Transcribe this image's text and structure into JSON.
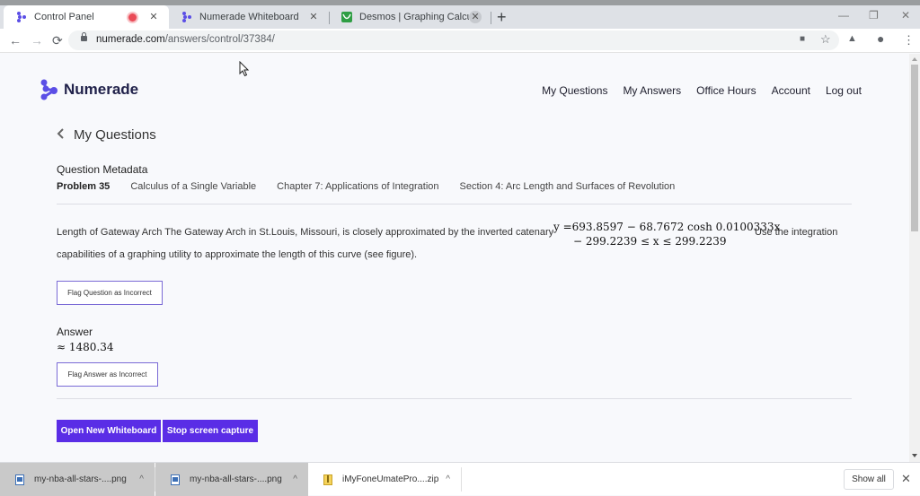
{
  "browser": {
    "tabs": [
      {
        "title": "Control Panel",
        "active": true,
        "recording": true
      },
      {
        "title": "Numerade Whiteboard",
        "active": false
      },
      {
        "title": "Desmos | Graphing Calculator",
        "active": false
      }
    ],
    "url_host": "numerade.com",
    "url_path": "/answers/control/37384/",
    "icons": {
      "back": "←",
      "forward": "→",
      "reload": "⟳",
      "close": "✕",
      "new_tab": "+",
      "minimize": "—",
      "restore": "❐",
      "window_close": "✕",
      "camera": "■",
      "star": "☆",
      "drive": "▲",
      "profile": "●",
      "menu": "⋮"
    }
  },
  "site": {
    "brand": "Numerade",
    "brand_color": "#5b4ee6",
    "nav": [
      "My Questions",
      "My Answers",
      "Office Hours",
      "Account",
      "Log out"
    ]
  },
  "page": {
    "back_label": "My Questions",
    "back_chevron": "‹",
    "metadata_title": "Question Metadata",
    "problem": "Problem 35",
    "book": "Calculus of a Single Variable",
    "chapter": "Chapter 7: Applications of Integration",
    "section": "Section 4: Arc Length and Surfaces of Revolution",
    "question_text_1": "Length of Gateway Arch The Gateway Arch in St.Louis, Missouri, is closely approximated by the inverted catenary",
    "math_line1": "y =693.8597 − 68.7672 cosh 0.0100333x",
    "math_line2": "− 299.2239 ≤ x ≤ 299.2239",
    "question_text_after": "Use the integration",
    "question_text_2": "capabilities of a graphing utility to approximate the length of this curve (see figure).",
    "flag_question_label": "Flag Question as Incorrect",
    "answer_label": "Answer",
    "answer_value": "≈ 1480.34",
    "flag_answer_label": "Flag Answer as Incorrect",
    "open_whiteboard_label": "Open New Whiteboard",
    "stop_capture_label": "Stop screen capture",
    "primary_color": "#5a2de6"
  },
  "downloads": {
    "items": [
      {
        "name": "my-nba-all-stars-....png",
        "type": "image"
      },
      {
        "name": "my-nba-all-stars-....png",
        "type": "image"
      },
      {
        "name": "iMyFoneUmatePro....zip",
        "type": "zip"
      }
    ],
    "caret": "^",
    "show_all_label": "Show all",
    "close": "✕"
  }
}
